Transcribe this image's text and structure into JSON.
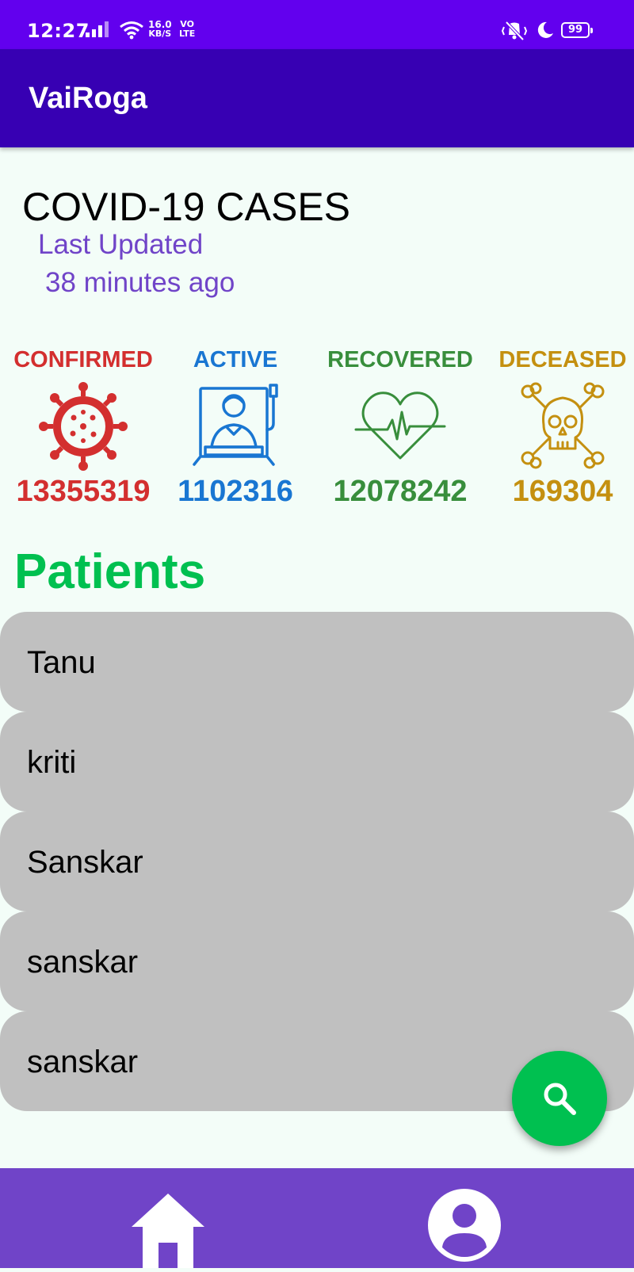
{
  "status_bar": {
    "time": "12:27",
    "net_speed_value": "16.0",
    "net_speed_unit": "KB/S",
    "volte_top": "VO",
    "volte_bottom": "LTE",
    "battery": "99",
    "icons": [
      "signal-bars-icon",
      "wifi-icon",
      "vibrate-mute-icon",
      "moon-icon",
      "battery-icon"
    ]
  },
  "app_bar": {
    "title": "VaiRoga"
  },
  "summary": {
    "title": "COVID-19 CASES",
    "last_updated_label": "Last Updated",
    "last_updated_ago": "38 minutes ago"
  },
  "stats": [
    {
      "label": "CONFIRMED",
      "value": "13355319",
      "color": "#d32f2f",
      "icon": "virus-icon"
    },
    {
      "label": "ACTIVE",
      "value": "1102316",
      "color": "#1976d2",
      "icon": "hospital-bed-patient-icon"
    },
    {
      "label": "RECOVERED",
      "value": "12078242",
      "color": "#388e3c",
      "icon": "heart-pulse-icon"
    },
    {
      "label": "DECEASED",
      "value": "169304",
      "color": "#c49010",
      "icon": "skull-crossbones-icon"
    }
  ],
  "patients": {
    "heading": "Patients",
    "items": [
      "Tanu",
      "kriti",
      "Sanskar",
      "sanskar",
      "sanskar"
    ]
  },
  "fab": {
    "icon": "search-icon"
  },
  "bottom_nav": {
    "items": [
      {
        "icon": "home-icon"
      },
      {
        "icon": "profile-icon"
      }
    ]
  },
  "colors": {
    "status_bar": "#6200ee",
    "app_bar": "#3700b3",
    "background": "#f3fdf8",
    "accent_purple": "#7044c8",
    "accent_green": "#00c050",
    "list_item_bg": "#c0c0c0"
  }
}
